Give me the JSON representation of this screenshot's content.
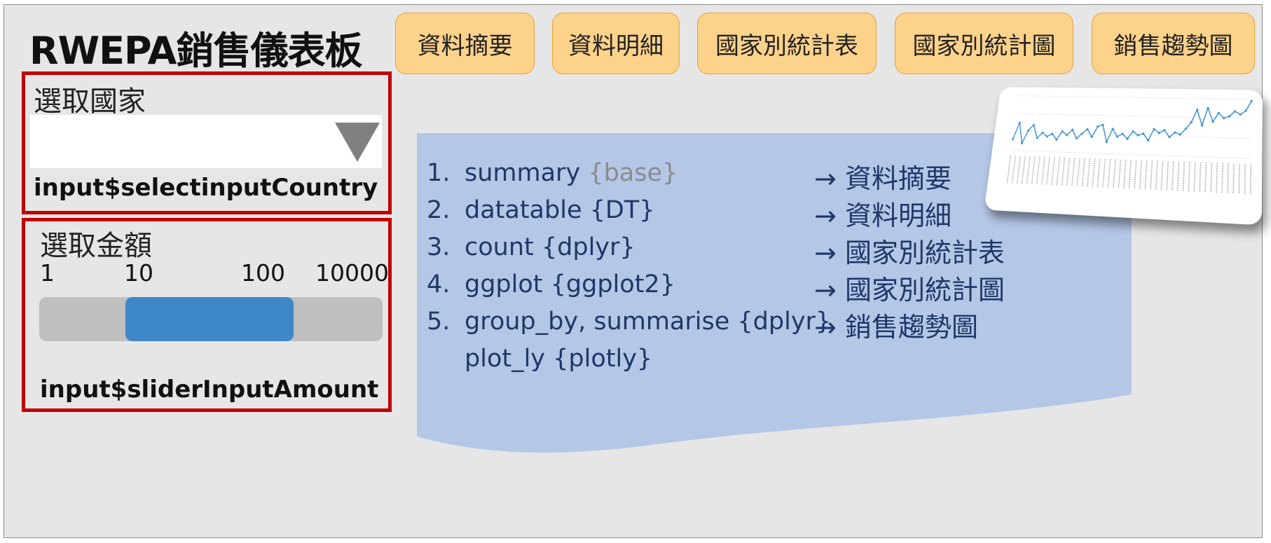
{
  "title": "RWEPA銷售儀表板",
  "tabs": [
    "資料摘要",
    "資料明細",
    "國家別統計表",
    "國家別統計圖",
    "銷售趨勢圖"
  ],
  "country_box": {
    "label": "選取國家",
    "selected_value": "",
    "variable": "input$selectinputCountry"
  },
  "amount_box": {
    "label": "選取金額",
    "ticks": [
      "1",
      "10",
      "100",
      "10000"
    ],
    "slider_range": [
      0.25,
      0.74
    ],
    "variable": "input$sliderInputAmount"
  },
  "functions": [
    {
      "num": "1.",
      "name": "summary ",
      "pkg": "{base}",
      "pkg_style": "gray",
      "result": "資料摘要"
    },
    {
      "num": "2.",
      "name": "datatable {DT}",
      "pkg": "",
      "result": "資料明細"
    },
    {
      "num": "3.",
      "name": "count {dplyr}",
      "pkg": "",
      "result": "國家別統計表"
    },
    {
      "num": "4.",
      "name": "ggplot {ggplot2}",
      "pkg": "",
      "result": "國家別統計圖"
    },
    {
      "num": "5.",
      "name": "group_by, summarise {dplyr}",
      "pkg": "",
      "result": "銷售趨勢圖"
    },
    {
      "num": "",
      "name": "plot_ly {plotly}",
      "pkg": "",
      "result": ""
    }
  ],
  "arrow_glyph": "→",
  "colors": {
    "background": "#e6e6e6",
    "tab_fill": "#fdd28a",
    "tab_border": "#e3a23a",
    "highlight_border": "#c00000",
    "slider_fill": "#3e87c8",
    "slider_track": "#bfbfbf",
    "panel_fill": "#b4c7e7",
    "text_navy": "#1f3866"
  },
  "thumbnail_chart": {
    "type": "line",
    "values": [
      12,
      30,
      8,
      22,
      28,
      14,
      20,
      16,
      19,
      13,
      22,
      18,
      24,
      15,
      20,
      25,
      17,
      28,
      30,
      12,
      26,
      18,
      21,
      16,
      24,
      20,
      22,
      15,
      27,
      23,
      26,
      19,
      24,
      22,
      28,
      35,
      48,
      32,
      50,
      36,
      45,
      40,
      42,
      47,
      44,
      48,
      58
    ],
    "color": "#3b8fd0"
  }
}
